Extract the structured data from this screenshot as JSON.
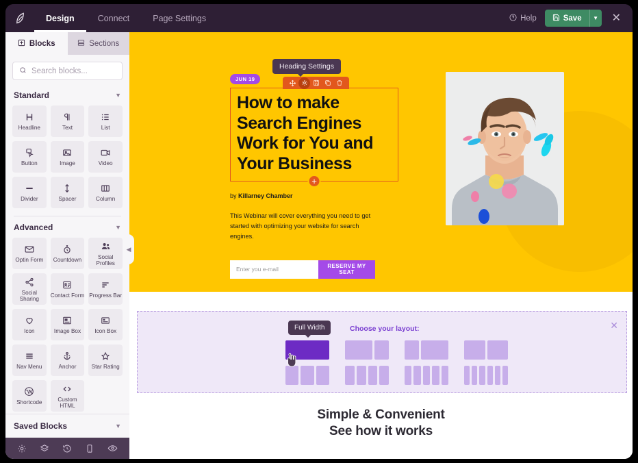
{
  "topbar": {
    "logo_icon": "brand-leaf-icon",
    "nav": [
      {
        "label": "Design",
        "active": true
      },
      {
        "label": "Connect",
        "active": false
      },
      {
        "label": "Page Settings",
        "active": false
      }
    ],
    "help_label": "Help",
    "help_icon": "question-circle-icon",
    "save_label": "Save",
    "save_icon": "floppy-disk-icon",
    "save_caret_icon": "chevron-down-icon",
    "close_icon": "close-icon",
    "save_color": "#3e8b63",
    "bar_color": "#2e1f35"
  },
  "sidebar": {
    "tabs": [
      {
        "label": "Blocks",
        "icon": "blocks-grid-icon",
        "active": true
      },
      {
        "label": "Sections",
        "icon": "sections-rows-icon",
        "active": false
      }
    ],
    "search": {
      "placeholder": "Search blocks...",
      "value": "",
      "icon": "search-icon"
    },
    "groups": [
      {
        "title": "Standard",
        "chevron_icon": "chevron-down-icon",
        "blocks": [
          {
            "label": "Headline",
            "icon": "headline-h-icon"
          },
          {
            "label": "Text",
            "icon": "paragraph-pilcrow-icon"
          },
          {
            "label": "List",
            "icon": "list-icon"
          },
          {
            "label": "Button",
            "icon": "button-cursor-icon"
          },
          {
            "label": "Image",
            "icon": "image-icon"
          },
          {
            "label": "Video",
            "icon": "video-camera-icon"
          },
          {
            "label": "Divider",
            "icon": "divider-icon"
          },
          {
            "label": "Spacer",
            "icon": "spacer-arrows-icon"
          },
          {
            "label": "Column",
            "icon": "columns-icon"
          }
        ]
      },
      {
        "title": "Advanced",
        "chevron_icon": "chevron-down-icon",
        "blocks": [
          {
            "label": "Optin Form",
            "icon": "envelope-icon"
          },
          {
            "label": "Countdown",
            "icon": "stopwatch-icon"
          },
          {
            "label": "Social Profiles",
            "icon": "users-group-icon"
          },
          {
            "label": "Social Sharing",
            "icon": "share-nodes-icon"
          },
          {
            "label": "Contact Form",
            "icon": "contact-form-icon"
          },
          {
            "label": "Progress Bar",
            "icon": "progress-bar-icon"
          },
          {
            "label": "Icon",
            "icon": "heart-icon"
          },
          {
            "label": "Image Box",
            "icon": "image-box-icon"
          },
          {
            "label": "Icon Box",
            "icon": "icon-box-icon"
          },
          {
            "label": "Nav Menu",
            "icon": "hamburger-menu-icon"
          },
          {
            "label": "Anchor",
            "icon": "anchor-icon"
          },
          {
            "label": "Star Rating",
            "icon": "star-icon"
          },
          {
            "label": "Shortcode",
            "icon": "wordpress-icon"
          },
          {
            "label": "Custom HTML",
            "icon": "code-brackets-icon"
          }
        ]
      }
    ],
    "saved_blocks": {
      "title": "Saved Blocks",
      "chevron_icon": "chevron-down-icon"
    },
    "bottom_bar_icons": [
      "gear-icon",
      "layers-icon",
      "history-clock-icon",
      "mobile-device-icon",
      "eye-preview-icon"
    ],
    "collapse_icon": "chevron-left-icon"
  },
  "canvas": {
    "hero": {
      "background_color": "#ffc600",
      "date_badge": "JUN 19",
      "element_tooltip": "Heading Settings",
      "element_toolbar_icons": [
        {
          "name": "move-drag-icon",
          "active": false
        },
        {
          "name": "gear-settings-icon",
          "active": true
        },
        {
          "name": "save-block-icon",
          "active": false
        },
        {
          "name": "duplicate-icon",
          "active": false
        },
        {
          "name": "trash-delete-icon",
          "active": false
        }
      ],
      "add_block_icon": "plus-circle-icon",
      "heading": "How to make Search Engines Work for You and Your Business",
      "byline_prefix": "by",
      "byline_author": "Killarney Chamber",
      "description": "This Webinar will cover everything you need to get started with optimizing your website for search engines.",
      "optin": {
        "placeholder": "Enter you e-mail",
        "value": "",
        "button_label": "RESERVE MY SEAT",
        "button_color": "#a44ae8"
      },
      "photo_alt": "portrait-photo"
    },
    "layout_picker": {
      "tooltip": "Full Width",
      "title": "Choose your layout:",
      "close_icon": "close-icon",
      "cursor_icon": "hand-pointer-cursor",
      "selected_index": 0,
      "options": [
        {
          "name": "full-width",
          "cols": [
            100
          ],
          "selected": true
        },
        {
          "name": "two-thirds-one-third",
          "cols": [
            62,
            33
          ]
        },
        {
          "name": "one-third-two-thirds",
          "cols": [
            33,
            62
          ]
        },
        {
          "name": "half-half",
          "cols": [
            48,
            48
          ]
        },
        {
          "name": "three-equal",
          "cols": [
            31,
            31,
            31
          ]
        },
        {
          "name": "four-equal",
          "cols": [
            22,
            22,
            22,
            22
          ]
        },
        {
          "name": "five-equal",
          "cols": [
            17,
            17,
            17,
            17,
            17
          ]
        },
        {
          "name": "six-equal",
          "cols": [
            14,
            14,
            14,
            14,
            14,
            14
          ]
        }
      ]
    },
    "promo": {
      "line1": "Simple & Convenient",
      "line2": "See how it works"
    }
  }
}
